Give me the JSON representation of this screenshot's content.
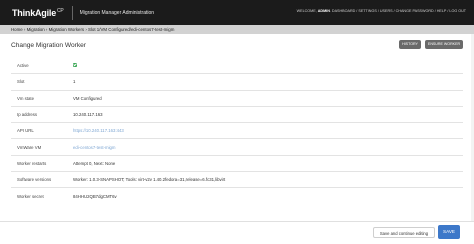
{
  "header": {
    "logo": "ThinkAgile",
    "logo_sup": "CP",
    "app_title": "Migration Manager Administration",
    "nav_prefix": "WELCOME,",
    "nav_user": "ADMIN",
    "nav_links": "DASHBOARD / SETTINGS / USERS / CHANGE PASSWORD / HELP / LOG OUT"
  },
  "breadcrumb": "Home › Migration › Migration Workers › Slot 1/VM Configured/edi-centos7-test-migm",
  "page": {
    "title": "Change Migration Worker",
    "history_label": "HISTORY",
    "ensure_label": "ENSURE WORKER"
  },
  "fields": [
    {
      "label": "Active",
      "value": ""
    },
    {
      "label": "Slot",
      "value": "1"
    },
    {
      "label": "Vm state",
      "value": "VM Configured"
    },
    {
      "label": "Ip address",
      "value": "10.240.117.163"
    },
    {
      "label": "API URL",
      "value": "https://10.240.117.163:443"
    },
    {
      "label": "VmWare VM",
      "value": "edi-centos7-test-migm"
    },
    {
      "label": "Worker restarts",
      "value": "Attempt 0, Next: None"
    },
    {
      "label": "Software versions",
      "value": "Worker: 1.0.3-SNAPSHOT; Tools: virt-v2v 1.40.2fedora=31,release=6.fc31,libvirt"
    },
    {
      "label": "Worker secret",
      "value": "84HHU2QB7dgCMT6v"
    }
  ],
  "footer": {
    "save_continue_label": "Save and continue editing",
    "save_label": "SAVE"
  },
  "colors": {
    "topbar": "#1b1b1b",
    "breadcrumb_bg": "#d2d2d2",
    "active_check": "#3aa655",
    "link": "#7fa7d3",
    "save": "#3d78c9",
    "header_button": "#6a6a6a"
  },
  "icons": {
    "active_indicator": "check-icon"
  }
}
